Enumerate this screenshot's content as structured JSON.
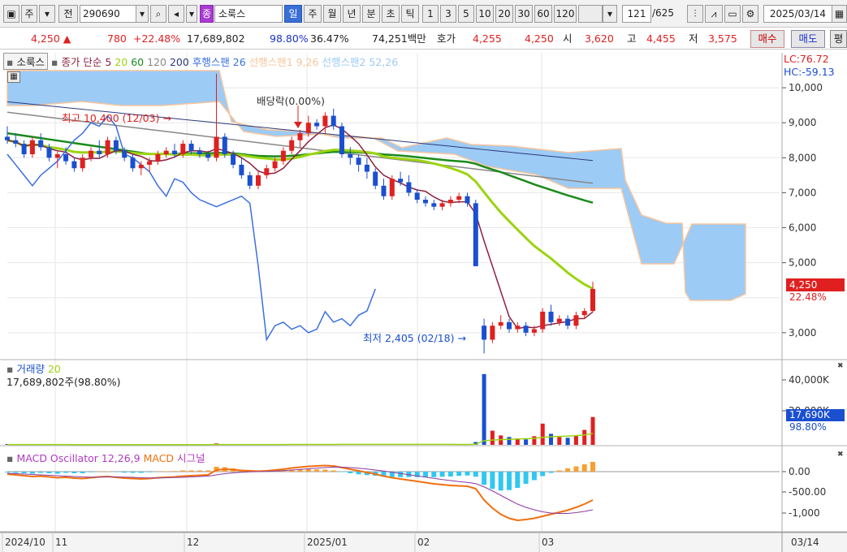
{
  "toolbar": {
    "period_toggle": "주",
    "prev_label": "전",
    "code": "290690",
    "stock_badge": "종",
    "stock_name": "소룩스",
    "tabs": [
      "일",
      "주",
      "월",
      "년",
      "분",
      "초",
      "틱"
    ],
    "active_tab": "일",
    "intervals": [
      "1",
      "3",
      "5",
      "10",
      "20",
      "30",
      "60",
      "120"
    ],
    "count": "121",
    "total": "/625",
    "date": "2025/03/14"
  },
  "quote": {
    "price": "4,250",
    "change": "780",
    "change_pct": "+22.48%",
    "volume": "17,689,802",
    "vol_ratio": "98.80%",
    "turnover": "36.47%",
    "amount": "74,251백만",
    "bid_label": "호가",
    "ask": "4,255",
    "bid": "4,250",
    "open_label": "시",
    "open": "3,620",
    "high_label": "고",
    "high": "4,455",
    "low_label": "저",
    "low": "3,575",
    "buy_label": "매수",
    "sell_label": "매도",
    "eval_label": "평"
  },
  "legend": {
    "name": "소룩스",
    "close": "종가 단순",
    "ma5": "5",
    "ma20": "20",
    "ma60": "60",
    "ma120": "120",
    "ma200": "200",
    "lag": "후행스팬 26",
    "lead1": "선행스팬1 9,26",
    "lead2": "선행스팬2 52,26",
    "lc": "LC:76.72",
    "hc": "HC:-59.13"
  },
  "annotations": {
    "high": "최고 10,400 (12/03)",
    "dividend": "배당락(0.00%)",
    "low": "최저 2,405 (02/18)"
  },
  "price_axis": [
    "10,000",
    "9,000",
    "8,000",
    "7,000",
    "6,000",
    "5,000",
    "3,000"
  ],
  "current": {
    "price": "4,250",
    "pct": "22.48%"
  },
  "volume_panel": {
    "title": "거래량",
    "ma": "20",
    "info": "17,689,802주(98.80%)",
    "axis": [
      "40,000K",
      "20,000K"
    ],
    "tag": "17,690K",
    "tag_pct": "98.80%"
  },
  "macd_panel": {
    "title": "MACD Oscillator 12,26,9",
    "macd": "MACD",
    "signal": "시그널",
    "axis": [
      "0.00",
      "-500.00",
      "-1,000"
    ]
  },
  "time_axis": [
    "2024/10",
    "11",
    "12",
    "2025/01",
    "02",
    "03",
    "03/14"
  ],
  "colors": {
    "up": "#e02020",
    "down": "#1a4fd0",
    "cloud": "#9ccbf5",
    "ma5": "#8b2040",
    "ma20": "#9bd410",
    "ma60": "#1a8a1a",
    "ma120": "#888888",
    "ma200": "#2a3a7a",
    "lag": "#3a6fe0",
    "macd": "#f07010",
    "signal": "#8e3aa0"
  },
  "chart_data": {
    "type": "candlestick",
    "price_range": [
      2300,
      11000
    ],
    "dates_x_index": [
      "2024/10",
      "11",
      "12",
      "2025/01",
      "02",
      "03"
    ],
    "ohlc_daily_approx": [
      [
        8600,
        8900,
        8400,
        8500
      ],
      [
        8500,
        8700,
        8300,
        8400
      ],
      [
        8400,
        8500,
        8000,
        8100
      ],
      [
        8100,
        8600,
        8000,
        8500
      ],
      [
        8500,
        8700,
        8200,
        8300
      ],
      [
        8300,
        8400,
        7900,
        8000
      ],
      [
        8000,
        8200,
        7700,
        8100
      ],
      [
        8100,
        8300,
        7800,
        7900
      ],
      [
        7900,
        8000,
        7600,
        7700
      ],
      [
        7700,
        8100,
        7600,
        8000
      ],
      [
        8000,
        8300,
        7900,
        8200
      ],
      [
        8200,
        8500,
        8000,
        8100
      ],
      [
        8100,
        8600,
        8000,
        8500
      ],
      [
        8500,
        8600,
        8100,
        8200
      ],
      [
        8200,
        8300,
        7900,
        8000
      ],
      [
        8000,
        8100,
        7600,
        7700
      ],
      [
        7700,
        7900,
        7500,
        7800
      ],
      [
        7800,
        8000,
        7600,
        7900
      ],
      [
        7900,
        8200,
        7800,
        8100
      ],
      [
        8100,
        8300,
        8000,
        8200
      ],
      [
        8200,
        8400,
        8000,
        8100
      ],
      [
        8100,
        8500,
        8000,
        8400
      ],
      [
        8400,
        8500,
        8100,
        8200
      ],
      [
        8200,
        8300,
        8000,
        8100
      ],
      [
        8100,
        8200,
        7900,
        8000
      ],
      [
        8000,
        10400,
        7900,
        8600
      ],
      [
        8600,
        8700,
        8000,
        8100
      ],
      [
        8100,
        8200,
        7700,
        7800
      ],
      [
        7800,
        8000,
        7400,
        7500
      ],
      [
        7500,
        7600,
        7100,
        7200
      ],
      [
        7200,
        7600,
        7100,
        7500
      ],
      [
        7500,
        7800,
        7400,
        7700
      ],
      [
        7700,
        8000,
        7600,
        7900
      ],
      [
        7900,
        8300,
        7800,
        8200
      ],
      [
        8200,
        8600,
        8100,
        8500
      ],
      [
        8500,
        8800,
        8300,
        8700
      ],
      [
        8700,
        9200,
        8600,
        9000
      ],
      [
        9000,
        9100,
        8800,
        8900
      ],
      [
        8900,
        9300,
        8700,
        9200
      ],
      [
        9200,
        9400,
        8800,
        8900
      ],
      [
        8900,
        9000,
        8000,
        8100
      ],
      [
        8100,
        8300,
        7800,
        8000
      ],
      [
        8000,
        8100,
        7600,
        7800
      ],
      [
        7800,
        8000,
        7400,
        7600
      ],
      [
        7600,
        7700,
        7100,
        7200
      ],
      [
        7200,
        7400,
        6800,
        6900
      ],
      [
        6900,
        7500,
        6800,
        7400
      ],
      [
        7400,
        7600,
        7200,
        7300
      ],
      [
        7300,
        7500,
        6900,
        7000
      ],
      [
        7000,
        7100,
        6700,
        6800
      ],
      [
        6800,
        6900,
        6600,
        6700
      ],
      [
        6700,
        6800,
        6500,
        6600
      ],
      [
        6600,
        6800,
        6500,
        6700
      ],
      [
        6700,
        6900,
        6600,
        6800
      ],
      [
        6800,
        7000,
        6700,
        6900
      ],
      [
        6900,
        7000,
        6600,
        6700
      ],
      [
        6700,
        6800,
        5800,
        4900
      ],
      [
        3200,
        3400,
        2405,
        2800
      ],
      [
        2800,
        3300,
        2700,
        3200
      ],
      [
        3200,
        3500,
        3100,
        3300
      ],
      [
        3300,
        3400,
        3000,
        3100
      ],
      [
        3100,
        3300,
        3000,
        3200
      ],
      [
        3200,
        3300,
        2900,
        3000
      ],
      [
        3000,
        3200,
        2900,
        3100
      ],
      [
        3100,
        3700,
        3000,
        3600
      ],
      [
        3600,
        3800,
        3200,
        3300
      ],
      [
        3300,
        3500,
        3200,
        3400
      ],
      [
        3400,
        3500,
        3100,
        3200
      ],
      [
        3200,
        3600,
        3100,
        3500
      ],
      [
        3500,
        3700,
        3400,
        3620
      ],
      [
        3620,
        4455,
        3575,
        4250
      ]
    ],
    "volume_k": [
      200,
      180,
      150,
      220,
      160,
      150,
      140,
      130,
      120,
      150,
      170,
      140,
      160,
      130,
      120,
      140,
      120,
      130,
      150,
      140,
      130,
      160,
      140,
      130,
      120,
      900,
      400,
      300,
      250,
      200,
      180,
      200,
      220,
      260,
      300,
      320,
      380,
      300,
      350,
      320,
      420,
      360,
      300,
      280,
      320,
      350,
      380,
      260,
      240,
      220,
      200,
      180,
      190,
      200,
      210,
      220,
      1800,
      45000,
      9000,
      6000,
      5000,
      4000,
      3500,
      5500,
      13500,
      7000,
      5000,
      4500,
      6000,
      9500,
      17690
    ],
    "macd": [
      -60,
      -80,
      -100,
      -120,
      -110,
      -130,
      -150,
      -140,
      -160,
      -170,
      -150,
      -130,
      -120,
      -140,
      -160,
      -170,
      -180,
      -170,
      -150,
      -140,
      -130,
      -110,
      -100,
      -90,
      -80,
      40,
      60,
      50,
      30,
      20,
      10,
      20,
      40,
      60,
      90,
      110,
      130,
      140,
      150,
      140,
      100,
      60,
      20,
      -20,
      -60,
      -110,
      -150,
      -180,
      -210,
      -240,
      -270,
      -300,
      -320,
      -340,
      -350,
      -360,
      -420,
      -700,
      -900,
      -1050,
      -1150,
      -1200,
      -1180,
      -1150,
      -1100,
      -1050,
      -1000,
      -950,
      -880,
      -800,
      -700
    ],
    "signal": [
      -40,
      -50,
      -60,
      -70,
      -80,
      -90,
      -100,
      -110,
      -120,
      -130,
      -135,
      -135,
      -130,
      -130,
      -135,
      -140,
      -150,
      -155,
      -155,
      -150,
      -145,
      -140,
      -130,
      -120,
      -110,
      -80,
      -50,
      -30,
      -15,
      -5,
      0,
      5,
      15,
      25,
      40,
      55,
      70,
      85,
      100,
      110,
      110,
      100,
      85,
      65,
      40,
      15,
      -15,
      -45,
      -75,
      -105,
      -135,
      -165,
      -195,
      -220,
      -245,
      -265,
      -295,
      -375,
      -475,
      -585,
      -695,
      -800,
      -880,
      -940,
      -990,
      -1020,
      -1030,
      -1030,
      -1010,
      -980,
      -940
    ]
  }
}
